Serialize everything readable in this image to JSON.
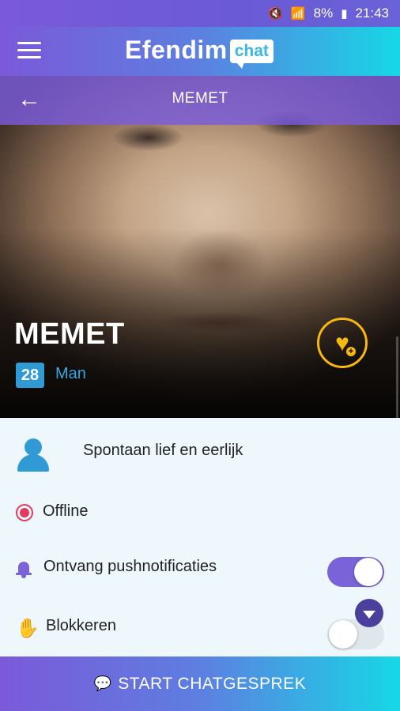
{
  "status_bar": {
    "battery": "8%",
    "time": "21:43",
    "icons": [
      "mute-icon",
      "wifi-icon",
      "signal-icon",
      "battery-icon"
    ]
  },
  "app_bar": {
    "brand_name": "Efendim",
    "brand_chat": "chat",
    "menu_icon": "hamburger-menu-icon"
  },
  "sub_header": {
    "back_icon": "arrow-left-icon",
    "title": "MEMET"
  },
  "profile": {
    "name": "MEMET",
    "age": "28",
    "gender": "Man",
    "favorite_icon": "heart-plus-icon",
    "bio": "Spontaan lief en eerlijk",
    "status": "Offline"
  },
  "settings": {
    "notifications_label": "Ontvang pushnotificaties",
    "notifications_on": true,
    "block_label": "Blokkeren",
    "block_on": false
  },
  "cta": {
    "icon": "chat-bubbles-icon",
    "label": "START CHATGESPREK"
  },
  "colors": {
    "accent_purple": "#7a62d8",
    "accent_cyan": "#16d7e6",
    "badge_blue": "#2f9ad4",
    "favorite_gold": "#f6b70f",
    "offline_red": "#e13a5e"
  }
}
